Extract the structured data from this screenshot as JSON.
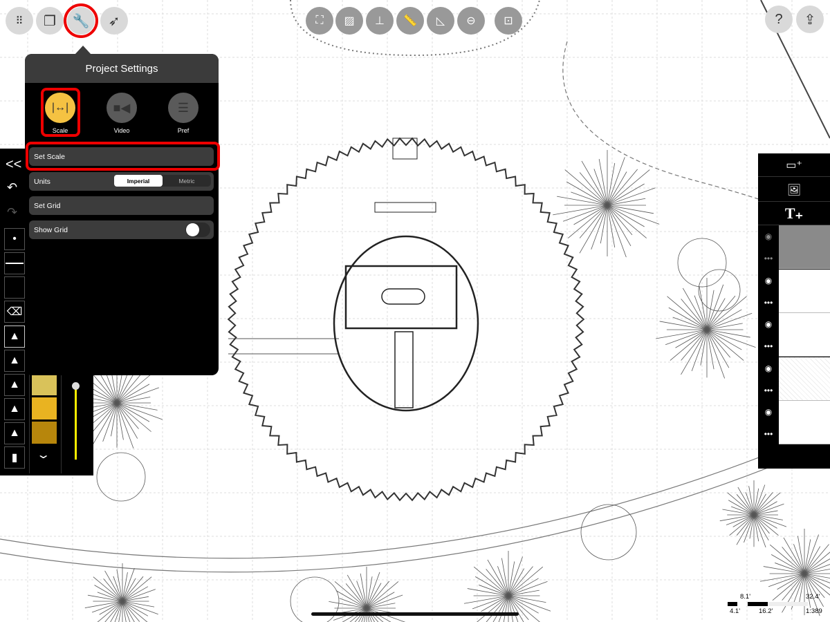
{
  "toolbar_left": [
    {
      "name": "grid-menu",
      "icon": "grid-back-icon"
    },
    {
      "name": "pages",
      "icon": "stacked-windows-icon"
    },
    {
      "name": "settings",
      "icon": "wrench-icon",
      "highlighted": true
    },
    {
      "name": "select",
      "icon": "lasso-arrow-icon"
    }
  ],
  "toolbar_center": [
    {
      "name": "transform",
      "icon": "transform-icon"
    },
    {
      "name": "hatch",
      "icon": "hatch-icon"
    },
    {
      "name": "axis",
      "icon": "axis-icon"
    },
    {
      "name": "ruler",
      "icon": "ruler-icon"
    },
    {
      "name": "triangle",
      "icon": "set-square-icon"
    },
    {
      "name": "shape",
      "icon": "circle-minus-icon"
    },
    {
      "name": "stamp",
      "icon": "tree-stamp-icon"
    }
  ],
  "toolbar_right": {
    "help": "?",
    "share": "share-icon"
  },
  "popover": {
    "title": "Project Settings",
    "options": [
      {
        "label": "Scale",
        "active": true
      },
      {
        "label": "Video"
      },
      {
        "label": "Pref"
      }
    ],
    "rows": {
      "set_scale": "Set Scale",
      "units": "Units",
      "units_options": [
        "Imperial",
        "Metric"
      ],
      "units_selected": "Imperial",
      "set_grid": "Set Grid",
      "show_grid": "Show Grid",
      "show_grid_on": false
    },
    "accent": "#f5c242",
    "highlight": "#e00000"
  },
  "left_tools": {
    "collapse": "<<",
    "swatches": [
      "#d9c25a",
      "#e9b321",
      "#b7860c"
    ],
    "slider_color": "#ffee00",
    "expand": "chevron-down-icon"
  },
  "right_panel": {
    "buttons": [
      "add-page-icon",
      "add-image-icon",
      "add-text-icon"
    ],
    "layers": [
      {
        "visible": true,
        "selected": true
      },
      {
        "visible": true
      },
      {
        "visible": true
      },
      {
        "visible": true,
        "has_image": true
      },
      {
        "visible": true
      }
    ]
  },
  "scale_bar": {
    "top": [
      "8.1'",
      "32.4'"
    ],
    "bottom": [
      "4.1'",
      "16.2'",
      "1:389"
    ]
  }
}
